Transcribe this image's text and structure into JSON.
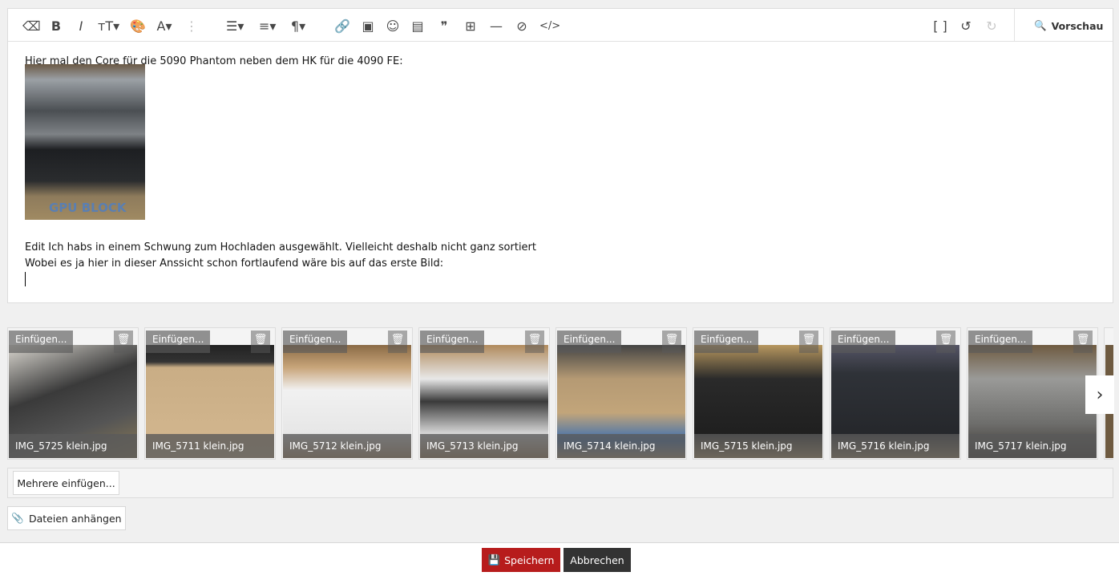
{
  "toolbar": {
    "items": [
      {
        "name": "clear-format-icon",
        "glyph": "⌫"
      },
      {
        "name": "bold-icon",
        "glyph": "B"
      },
      {
        "name": "italic-icon",
        "glyph": "I"
      },
      {
        "name": "font-size-icon",
        "glyph": "тT▾"
      },
      {
        "name": "color-palette-icon",
        "glyph": "🎨"
      },
      {
        "name": "font-family-icon",
        "glyph": "A▾"
      },
      {
        "name": "more-options-icon",
        "glyph": "⋮"
      },
      {
        "name": "list-icon",
        "glyph": "☰▾"
      },
      {
        "name": "align-icon",
        "glyph": "≡▾"
      },
      {
        "name": "paragraph-icon",
        "glyph": "¶▾"
      },
      {
        "name": "link-icon",
        "glyph": "🔗"
      },
      {
        "name": "image-icon",
        "glyph": "▣"
      },
      {
        "name": "emoji-icon",
        "glyph": "☺"
      },
      {
        "name": "media-gallery-icon",
        "glyph": "▤"
      },
      {
        "name": "quote-icon",
        "glyph": "❞"
      },
      {
        "name": "table-icon",
        "glyph": "⊞"
      },
      {
        "name": "horizontal-rule-icon",
        "glyph": "—"
      },
      {
        "name": "spoiler-icon",
        "glyph": "⊘"
      },
      {
        "name": "code-icon",
        "glyph": "</>"
      }
    ],
    "right": [
      {
        "name": "bbcode-toggle-icon",
        "glyph": "[ ]"
      },
      {
        "name": "undo-icon",
        "glyph": "↺"
      },
      {
        "name": "redo-icon",
        "glyph": "↻"
      }
    ],
    "preview_label": "Vorschau"
  },
  "content": {
    "line1": "Hier mal den Core für die 5090 Phantom neben dem HK für die 4090 FE:",
    "image_text": "GPU BLOCK",
    "line2": "Edit Ich habs in einem Schwung zum Hochladen ausgewählt. Vielleicht deshalb nicht ganz sortiert",
    "line3": "Wobei es ja hier in dieser Anssicht schon fortlaufend wäre bis auf das erste Bild:"
  },
  "attachments": {
    "insert_label": "Einfügen...",
    "files": [
      "IMG_5725 klein.jpg",
      "IMG_5711 klein.jpg",
      "IMG_5712 klein.jpg",
      "IMG_5713 klein.jpg",
      "IMG_5714 klein.jpg",
      "IMG_5715 klein.jpg",
      "IMG_5716 klein.jpg",
      "IMG_5717 klein.jpg"
    ],
    "insert_multiple_label": "Mehrere einfügen...",
    "attach_label": "Dateien anhängen"
  },
  "footer": {
    "save_label": "Speichern",
    "cancel_label": "Abbrechen",
    "save_color": "#b71c1c",
    "cancel_color": "#333333"
  }
}
